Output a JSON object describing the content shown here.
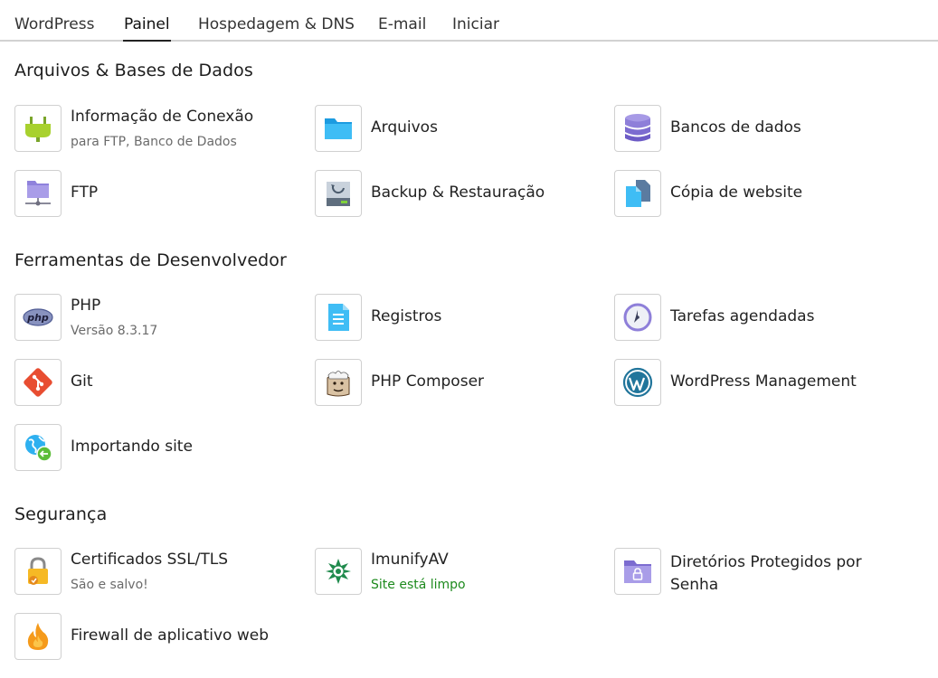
{
  "tabs": [
    "WordPress",
    "Painel",
    "Hospedagem & DNS",
    "E-mail",
    "Iniciar"
  ],
  "active_tab": "Painel",
  "sections": {
    "files": {
      "title": "Arquivos & Bases de Dados",
      "items": [
        {
          "label": "Informação de Conexão",
          "sub": "para FTP, Banco de Dados",
          "icon": "plug-icon"
        },
        {
          "label": "Arquivos",
          "icon": "folder-icon"
        },
        {
          "label": "Bancos de dados",
          "icon": "database-icon"
        },
        {
          "label": "FTP",
          "icon": "ftp-icon"
        },
        {
          "label": "Backup & Restauração",
          "icon": "backup-icon"
        },
        {
          "label": "Cópia de website",
          "icon": "website-copy-icon"
        }
      ]
    },
    "dev": {
      "title": "Ferramentas de Desenvolvedor",
      "items": [
        {
          "label": "PHP",
          "sub": "Versão 8.3.17",
          "icon": "php-icon"
        },
        {
          "label": "Registros",
          "icon": "logs-icon"
        },
        {
          "label": "Tarefas agendadas",
          "icon": "clock-icon"
        },
        {
          "label": "Git",
          "icon": "git-icon"
        },
        {
          "label": "PHP Composer",
          "icon": "composer-icon"
        },
        {
          "label": "WordPress Management",
          "icon": "wordpress-icon"
        },
        {
          "label": "Importando site",
          "icon": "import-site-icon"
        }
      ]
    },
    "security": {
      "title": "Segurança",
      "items": [
        {
          "label": "Certificados SSL/TLS",
          "sub": "São e salvo!",
          "icon": "ssl-lock-icon"
        },
        {
          "label": "ImunifyAV",
          "sub": "Site está limpo",
          "icon": "imunify-icon"
        },
        {
          "label": "Diretórios Protegidos por Senha",
          "icon": "protected-folder-icon"
        },
        {
          "label": "Firewall de aplicativo web",
          "icon": "fire-icon"
        }
      ]
    }
  },
  "colors": {
    "status_ok": "#1d8a1d",
    "folder_blue": "#2eb0f0",
    "purple": "#8e7fd9",
    "git_red": "#e84d31",
    "fire_orange": "#f59a1b"
  }
}
